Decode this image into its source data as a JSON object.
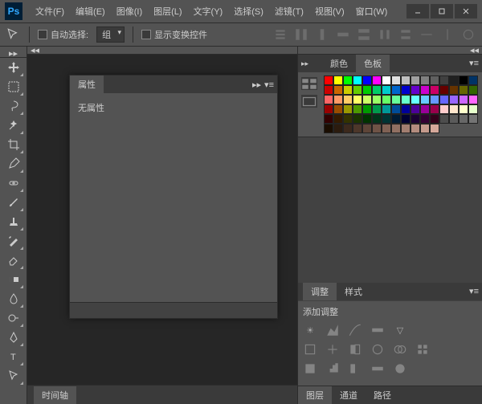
{
  "app": {
    "logo": "Ps"
  },
  "menu": {
    "file": "文件(F)",
    "edit": "编辑(E)",
    "image": "图像(I)",
    "layer": "图层(L)",
    "type": "文字(Y)",
    "select": "选择(S)",
    "filter": "滤镜(T)",
    "view": "视图(V)",
    "window": "窗口(W)"
  },
  "options": {
    "auto_select_label": "自动选择:",
    "auto_select_value": "组",
    "show_transform_label": "显示变换控件"
  },
  "panels": {
    "color_tab": "颜色",
    "swatches_tab": "色板",
    "adjustments_tab": "调整",
    "styles_tab": "样式",
    "add_adjustment_label": "添加调整",
    "layers_tab": "图层",
    "channels_tab": "通道",
    "paths_tab": "路径"
  },
  "properties": {
    "tab": "属性",
    "no_properties": "无属性"
  },
  "timeline": {
    "tab": "时间轴"
  },
  "swatches": [
    "#ff0000",
    "#ffff00",
    "#00ff00",
    "#00ffff",
    "#0000ff",
    "#ff00ff",
    "#ffffff",
    "#e0e0e0",
    "#c0c0c0",
    "#a0a0a0",
    "#808080",
    "#606060",
    "#404040",
    "#202020",
    "#000000",
    "#003366",
    "#cc0000",
    "#cc6600",
    "#cccc00",
    "#66cc00",
    "#00cc00",
    "#00cc66",
    "#00cccc",
    "#0066cc",
    "#0000cc",
    "#6600cc",
    "#cc00cc",
    "#cc0066",
    "#660000",
    "#663300",
    "#666600",
    "#336600",
    "#ff6666",
    "#ff9966",
    "#ffcc66",
    "#ffff66",
    "#ccff66",
    "#99ff66",
    "#66ff66",
    "#66ff99",
    "#66ffcc",
    "#66ffff",
    "#66ccff",
    "#6699ff",
    "#6666ff",
    "#9966ff",
    "#cc66ff",
    "#ff66ff",
    "#990000",
    "#994c00",
    "#999900",
    "#4c9900",
    "#009900",
    "#00994c",
    "#009999",
    "#004c99",
    "#000099",
    "#4c0099",
    "#990099",
    "#99004c",
    "#ffcccc",
    "#ffe6cc",
    "#ffffcc",
    "#e6ffcc",
    "#330000",
    "#331a00",
    "#333300",
    "#1a3300",
    "#003300",
    "#00331a",
    "#003333",
    "#001a33",
    "#000033",
    "#1a0033",
    "#330033",
    "#33001a",
    "#4d4d4d",
    "#5a5a5a",
    "#676767",
    "#747474",
    "#1a0d00",
    "#2b1b0e",
    "#3c291c",
    "#4d372a",
    "#5e4538",
    "#6f5346",
    "#806154",
    "#917062",
    "#a27e70",
    "#b38c7e",
    "#c49a8c",
    "#d5a89a"
  ]
}
